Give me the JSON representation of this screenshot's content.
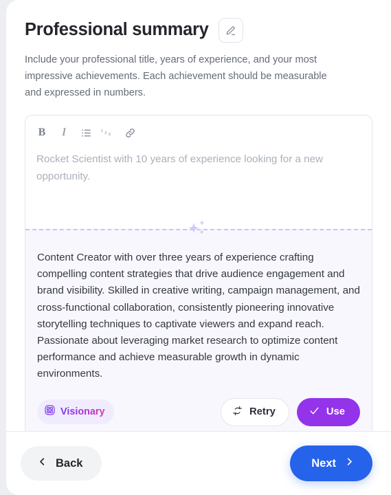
{
  "header": {
    "title": "Professional summary",
    "edit_icon": "pencil-edit-icon",
    "description": "Include your professional title, years of experience, and your most impressive achievements. Each achievement should be measurable and expressed in numbers."
  },
  "editor": {
    "toolbar": [
      {
        "name": "bold",
        "label": "B"
      },
      {
        "name": "italic",
        "label": "I"
      },
      {
        "name": "bulleted-list",
        "label": "bulleted-list-icon"
      },
      {
        "name": "numbered-list",
        "label": "numbered-list-icon"
      },
      {
        "name": "link",
        "label": "link-icon"
      }
    ],
    "placeholder": "Rocket Scientist with 10 years of experience looking for a new opportunity.",
    "value": ""
  },
  "suggestion": {
    "sparkle_icon": "sparkles-icon",
    "text": "Content Creator with over three years of experience crafting compelling content strategies that drive audience engagement and brand visibility. Skilled in creative writing, campaign management, and cross-functional collaboration, consistently pioneering innovative storytelling techniques to captivate viewers and expand reach. Passionate about leveraging market research to optimize content performance and achieve measurable growth in dynamic environments.",
    "badge_label": "Visionary",
    "badge_icon": "atom-icon",
    "retry_label": "Retry",
    "retry_icon": "refresh-icon",
    "use_label": "Use",
    "use_icon": "check-icon"
  },
  "footer": {
    "back_label": "Back",
    "back_icon": "chevron-left-icon",
    "next_label": "Next",
    "next_icon": "chevron-right-icon"
  },
  "colors": {
    "accent_purple": "#9333EA",
    "accent_blue": "#2563EB",
    "badge_bg": "#F1ECFD",
    "suggestion_bg": "#F8F7FE",
    "dashed_border": "#C9C5F5",
    "page_bg": "#ECEEF1"
  }
}
